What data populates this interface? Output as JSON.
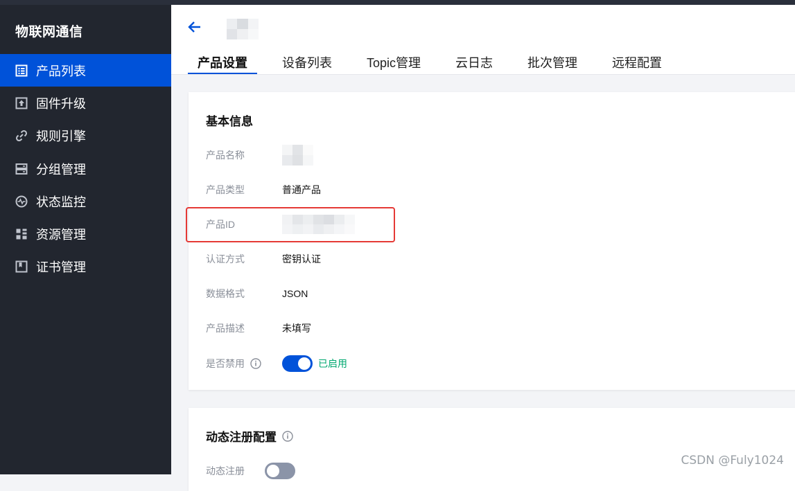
{
  "sidebar": {
    "brand": "物联网通信",
    "items": [
      {
        "label": "产品列表",
        "icon": "list-icon",
        "active": true
      },
      {
        "label": "固件升级",
        "icon": "upload-icon",
        "active": false
      },
      {
        "label": "规则引擎",
        "icon": "link-icon",
        "active": false
      },
      {
        "label": "分组管理",
        "icon": "server-icon",
        "active": false
      },
      {
        "label": "状态监控",
        "icon": "monitor-icon",
        "active": false
      },
      {
        "label": "资源管理",
        "icon": "grid-icon",
        "active": false
      },
      {
        "label": "证书管理",
        "icon": "bookmark-icon",
        "active": false
      }
    ]
  },
  "header": {
    "tabs": [
      "产品设置",
      "设备列表",
      "Topic管理",
      "云日志",
      "批次管理",
      "远程配置"
    ],
    "active_tab": "产品设置"
  },
  "basic_info": {
    "title": "基本信息",
    "product_name_label": "产品名称",
    "product_type_label": "产品类型",
    "product_type_value": "普通产品",
    "product_id_label": "产品ID",
    "auth_label": "认证方式",
    "auth_value": "密钥认证",
    "format_label": "数据格式",
    "format_value": "JSON",
    "desc_label": "产品描述",
    "desc_value": "未填写",
    "disabled_label": "是否禁用",
    "enabled_status": "已启用"
  },
  "dynamic_reg": {
    "title": "动态注册配置",
    "label": "动态注册"
  },
  "watermark": "CSDN @Fuly1024",
  "colors": {
    "accent": "#0052d9",
    "sidebar_bg": "#22262f",
    "success": "#00a870",
    "highlight": "#e53935"
  }
}
